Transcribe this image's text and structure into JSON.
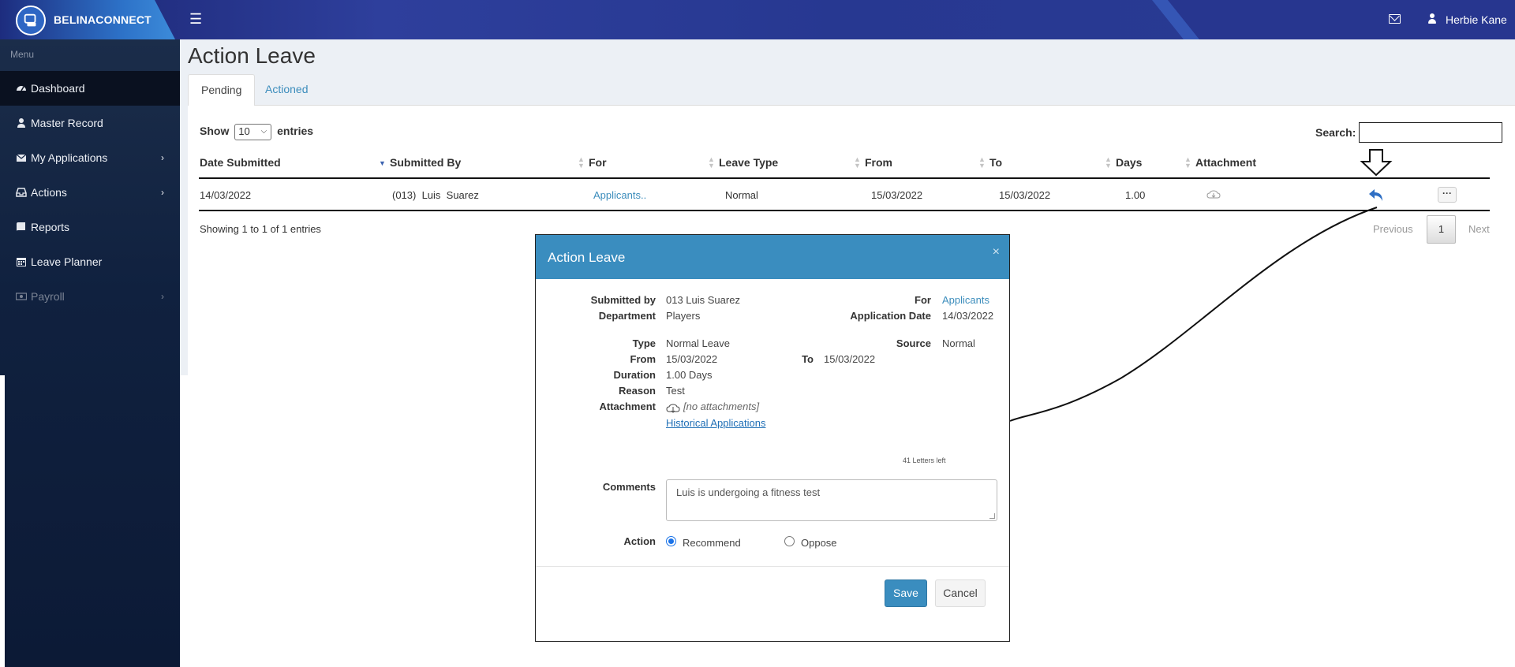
{
  "app": {
    "brand": "BELINACONNECT",
    "user_name": "Herbie Kane"
  },
  "sidebar": {
    "menu_label": "Menu",
    "items": [
      {
        "label": "Dashboard",
        "icon": "dashboard-icon"
      },
      {
        "label": "Master Record",
        "icon": "user-icon"
      },
      {
        "label": "My Applications",
        "icon": "envelope-icon"
      },
      {
        "label": "Actions",
        "icon": "inbox-icon"
      },
      {
        "label": "Reports",
        "icon": "book-icon"
      },
      {
        "label": "Leave Planner",
        "icon": "calendar-icon"
      },
      {
        "label": "Payroll",
        "icon": "money-icon"
      }
    ]
  },
  "page": {
    "title": "Action Leave",
    "tabs": [
      {
        "label": "Pending"
      },
      {
        "label": "Actioned"
      }
    ]
  },
  "table": {
    "show_label": "Show",
    "entries_label": "entries",
    "page_size": "10",
    "search_label": "Search:",
    "columns": [
      "Date Submitted",
      "Submitted By",
      "For",
      "Leave Type",
      "From",
      "To",
      "Days",
      "Attachment"
    ],
    "rows": [
      {
        "date_submitted": "14/03/2022",
        "submitted_by": "(013)  Luis  Suarez",
        "for": "Applicants..",
        "leave_type": "Normal",
        "from": "15/03/2022",
        "to": "15/03/2022",
        "days": "1.00"
      }
    ],
    "more_label": "···",
    "showing": "Showing 1 to 1 of 1 entries",
    "pagination": {
      "previous": "Previous",
      "current": "1",
      "next": "Next"
    }
  },
  "modal": {
    "title": "Action Leave",
    "close": "×",
    "submitted_by_label": "Submitted by",
    "submitted_by": "013 Luis Suarez",
    "department_label": "Department",
    "department": "Players",
    "for_label": "For",
    "for": "Applicants",
    "application_date_label": "Application Date",
    "application_date": "14/03/2022",
    "type_label": "Type",
    "type": "Normal Leave",
    "source_label": "Source",
    "source": "Normal",
    "from_label": "From",
    "from": "15/03/2022",
    "to_label": "To",
    "to": "15/03/2022",
    "duration_label": "Duration",
    "duration": "1.00 Days",
    "reason_label": "Reason",
    "reason": "Test",
    "attachment_label": "Attachment",
    "attachment": "[no attachments]",
    "historical_link": "Historical Applications",
    "letters_left": "41 Letters left",
    "comments_label": "Comments",
    "comments": "Luis is undergoing a fitness test",
    "action_label": "Action",
    "recommend_label": "Recommend",
    "oppose_label": "Oppose",
    "save_label": "Save",
    "cancel_label": "Cancel"
  }
}
